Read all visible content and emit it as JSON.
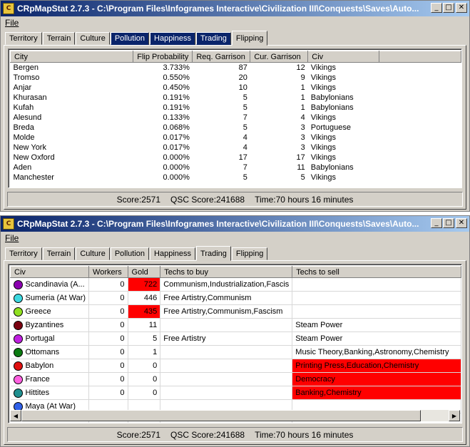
{
  "window1": {
    "title": "CRpMapStat 2.7.3 - C:\\Program Files\\Infogrames Interactive\\Civilization III\\Conquests\\Saves\\Auto...",
    "menu": [
      "File"
    ],
    "tabs": [
      "Territory",
      "Terrain",
      "Culture",
      "Pollution",
      "Happiness",
      "Trading",
      "Flipping"
    ],
    "active_tab": "Flipping",
    "columns": [
      "City",
      "Flip Probability",
      "Req. Garrison",
      "Cur. Garrison",
      "Civ"
    ],
    "rows": [
      [
        "Bergen",
        "3.733%",
        "87",
        "12",
        "Vikings"
      ],
      [
        "Tromso",
        "0.550%",
        "20",
        "9",
        "Vikings"
      ],
      [
        "Anjar",
        "0.450%",
        "10",
        "1",
        "Vikings"
      ],
      [
        "Khurasan",
        "0.191%",
        "5",
        "1",
        "Babylonians"
      ],
      [
        "Kufah",
        "0.191%",
        "5",
        "1",
        "Babylonians"
      ],
      [
        "Alesund",
        "0.133%",
        "7",
        "4",
        "Vikings"
      ],
      [
        "Breda",
        "0.068%",
        "5",
        "3",
        "Portuguese"
      ],
      [
        "Molde",
        "0.017%",
        "4",
        "3",
        "Vikings"
      ],
      [
        "New York",
        "0.017%",
        "4",
        "3",
        "Vikings"
      ],
      [
        "New Oxford",
        "0.000%",
        "17",
        "17",
        "Vikings"
      ],
      [
        "Aden",
        "0.000%",
        "7",
        "11",
        "Babylonians"
      ],
      [
        "Manchester",
        "0.000%",
        "5",
        "5",
        "Vikings"
      ]
    ],
    "status": {
      "score": "Score:2571",
      "qsc": "QSC Score:241688",
      "time": "Time:70 hours 16 minutes"
    }
  },
  "window2": {
    "title": "CRpMapStat 2.7.3 - C:\\Program Files\\Infogrames Interactive\\Civilization III\\Conquests\\Saves\\Auto...",
    "menu": [
      "File"
    ],
    "tabs": [
      "Territory",
      "Terrain",
      "Culture",
      "Pollution",
      "Happiness",
      "Trading",
      "Flipping"
    ],
    "active_tab": "Trading",
    "columns": [
      "Civ",
      "Workers",
      "Gold",
      "Techs to buy",
      "Techs to sell"
    ],
    "rows": [
      {
        "civ": "Scandinavia (A...",
        "color": "#8b00b0",
        "workers": "0",
        "gold": "722",
        "gold_red": true,
        "buy": "Communism,Industrialization,Fascis",
        "sell": "",
        "sell_red": false
      },
      {
        "civ": "Sumeria (At War)",
        "color": "#3cd8e0",
        "workers": "0",
        "gold": "446",
        "gold_red": false,
        "buy": "Free Artistry,Communism",
        "sell": "",
        "sell_red": false
      },
      {
        "civ": "Greece",
        "color": "#90e020",
        "workers": "0",
        "gold": "435",
        "gold_red": true,
        "buy": "Free Artistry,Communism,Fascism",
        "sell": "",
        "sell_red": false
      },
      {
        "civ": "Byzantines",
        "color": "#7a0010",
        "workers": "0",
        "gold": "11",
        "gold_red": false,
        "buy": "",
        "sell": "Steam Power",
        "sell_red": false
      },
      {
        "civ": "Portugal",
        "color": "#c020e0",
        "workers": "0",
        "gold": "5",
        "gold_red": false,
        "buy": "Free Artistry",
        "sell": "Steam Power",
        "sell_red": false
      },
      {
        "civ": "Ottomans",
        "color": "#0a7a10",
        "workers": "0",
        "gold": "1",
        "gold_red": false,
        "buy": "",
        "sell": "Music Theory,Banking,Astronomy,Chemistry",
        "sell_red": false
      },
      {
        "civ": "Babylon",
        "color": "#e01010",
        "workers": "0",
        "gold": "0",
        "gold_red": false,
        "buy": "",
        "sell": "Printing Press,Education,Chemistry",
        "sell_red": true
      },
      {
        "civ": "France",
        "color": "#ff60e0",
        "workers": "0",
        "gold": "0",
        "gold_red": false,
        "buy": "",
        "sell": "Democracy",
        "sell_red": true
      },
      {
        "civ": "Hittites",
        "color": "#209090",
        "workers": "0",
        "gold": "0",
        "gold_red": false,
        "buy": "",
        "sell": "Banking,Chemistry",
        "sell_red": true
      },
      {
        "civ": "Maya (At War)",
        "color": "#3060e8",
        "workers": "",
        "gold": "",
        "gold_red": false,
        "buy": "",
        "sell": "",
        "sell_red": false
      }
    ],
    "status": {
      "score": "Score:2571",
      "qsc": "QSC Score:241688",
      "time": "Time:70 hours 16 minutes"
    }
  }
}
